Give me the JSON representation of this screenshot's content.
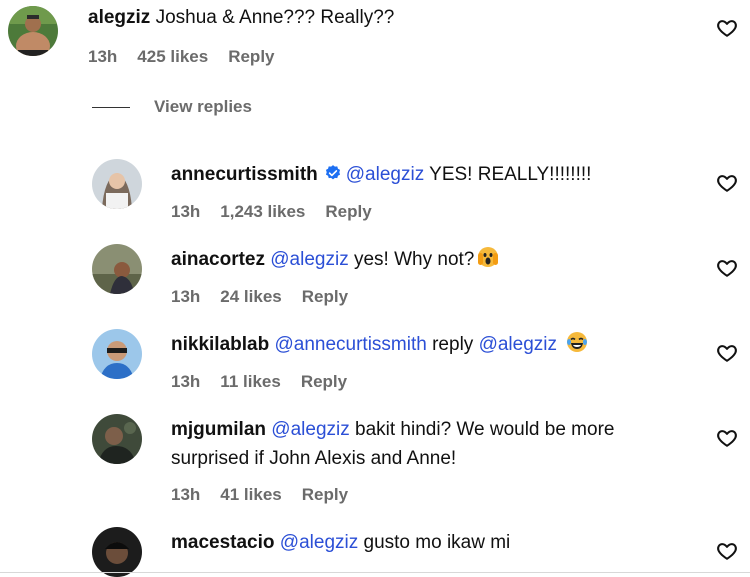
{
  "top_comment": {
    "username": "alegziz",
    "text": "Joshua & Anne??? Really??",
    "time": "13h",
    "likes": "425 likes",
    "reply": "Reply"
  },
  "view_replies": "View replies",
  "replies": [
    {
      "username": "annecurtissmith",
      "verified": true,
      "mention": "@alegziz",
      "text": "YES! REALLY!!!!!!!!",
      "time": "13h",
      "likes": "1,243 likes",
      "reply": "Reply"
    },
    {
      "username": "ainacortez",
      "mention": "@alegziz",
      "text": "yes! Why not?",
      "emoji": "screaming-face",
      "time": "13h",
      "likes": "24 likes",
      "reply": "Reply"
    },
    {
      "username": "nikkilablab",
      "mention": "@annecurtissmith",
      "text": "reply",
      "mention2": "@alegziz",
      "emoji": "tears-of-joy",
      "time": "13h",
      "likes": "11 likes",
      "reply": "Reply"
    },
    {
      "username": "mjgumilan",
      "mention": "@alegziz",
      "text": "bakit hindi? We would be more surprised if John Alexis and Anne!",
      "time": "13h",
      "likes": "41 likes",
      "reply": "Reply"
    },
    {
      "username": "macestacio",
      "mention": "@alegziz",
      "text": "gusto mo ikaw mi"
    }
  ],
  "colors": {
    "mention": "#2b4fd6",
    "verified": "#1d6ff2",
    "meta": "#6b6b6b"
  },
  "icons": [
    "heart-icon",
    "verified-badge-icon",
    "screaming-face-emoji",
    "tears-of-joy-emoji"
  ]
}
